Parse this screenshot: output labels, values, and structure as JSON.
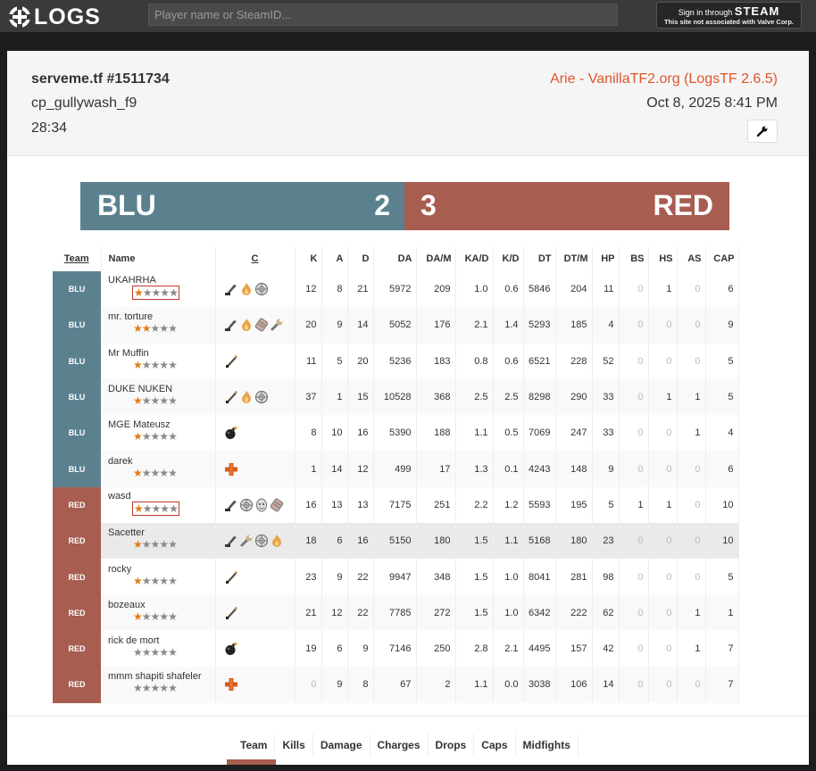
{
  "topbar": {
    "logo_text": "LOGS",
    "search_placeholder": "Player name or SteamID...",
    "steam_signin_prefix": "Sign in through",
    "steam_signin_brand": "STEAM",
    "steam_disclaimer": "This site not associated with Valve Corp."
  },
  "header": {
    "title": "serveme.tf #1511734",
    "map": "cp_gullywash_f9",
    "duration": "28:34",
    "uploader": "Arie - VanillaTF2.org (LogsTF 2.6.5)",
    "date": "Oct 8, 2025 8:41 PM",
    "wrench_icon": "wrench-icon"
  },
  "score": {
    "blu_name": "BLU",
    "blu_score": "2",
    "red_score": "3",
    "red_name": "RED",
    "blu_color": "#5b818f",
    "red_color": "#a75d50"
  },
  "table": {
    "headers": [
      "Team",
      "Name",
      "C",
      "K",
      "A",
      "D",
      "DA",
      "DA/M",
      "KA/D",
      "K/D",
      "DT",
      "DT/M",
      "HP",
      "BS",
      "HS",
      "AS",
      "CAP"
    ],
    "rows": [
      {
        "team": "BLU",
        "name": "UKAHRHA",
        "stars": 1,
        "boxed": true,
        "classes": [
          "scout",
          "pyro",
          "sniper"
        ],
        "stats": [
          "12",
          "8",
          "21",
          "5972",
          "209",
          "1.0",
          "0.6",
          "5846",
          "204",
          "11",
          "0",
          "1",
          "0",
          "6"
        ]
      },
      {
        "team": "BLU",
        "name": "mr. torture",
        "stars": 2,
        "boxed": false,
        "classes": [
          "scout",
          "pyro",
          "heavy",
          "engineer"
        ],
        "stats": [
          "20",
          "9",
          "14",
          "5052",
          "176",
          "2.1",
          "1.4",
          "5293",
          "185",
          "4",
          "0",
          "0",
          "0",
          "9"
        ]
      },
      {
        "team": "BLU",
        "name": "Mr Muffin",
        "stars": 1,
        "boxed": false,
        "classes": [
          "soldier"
        ],
        "stats": [
          "11",
          "5",
          "20",
          "5236",
          "183",
          "0.8",
          "0.6",
          "6521",
          "228",
          "52",
          "0",
          "0",
          "0",
          "5"
        ]
      },
      {
        "team": "BLU",
        "name": "DUKE NUKEN",
        "stars": 1,
        "boxed": false,
        "classes": [
          "soldier",
          "pyro",
          "sniper"
        ],
        "stats": [
          "37",
          "1",
          "15",
          "10528",
          "368",
          "2.5",
          "2.5",
          "8298",
          "290",
          "33",
          "0",
          "1",
          "1",
          "5"
        ]
      },
      {
        "team": "BLU",
        "name": "MGE Mateusz",
        "stars": 1,
        "boxed": false,
        "classes": [
          "demoman"
        ],
        "stats": [
          "8",
          "10",
          "16",
          "5390",
          "188",
          "1.1",
          "0.5",
          "7069",
          "247",
          "33",
          "0",
          "0",
          "1",
          "4"
        ]
      },
      {
        "team": "BLU",
        "name": "darek",
        "stars": 1,
        "boxed": false,
        "classes": [
          "medic"
        ],
        "stats": [
          "1",
          "14",
          "12",
          "499",
          "17",
          "1.3",
          "0.1",
          "4243",
          "148",
          "9",
          "0",
          "0",
          "0",
          "6"
        ]
      },
      {
        "team": "RED",
        "name": "wasd",
        "stars": 1,
        "boxed": true,
        "classes": [
          "scout",
          "sniper",
          "spy",
          "heavy"
        ],
        "stats": [
          "16",
          "13",
          "13",
          "7175",
          "251",
          "2.2",
          "1.2",
          "5593",
          "195",
          "5",
          "1",
          "1",
          "0",
          "10"
        ]
      },
      {
        "team": "RED",
        "name": "Sacetter",
        "stars": 1,
        "boxed": false,
        "classes": [
          "scout",
          "engineer",
          "sniper",
          "pyro"
        ],
        "stats": [
          "18",
          "6",
          "16",
          "5150",
          "180",
          "1.5",
          "1.1",
          "5168",
          "180",
          "23",
          "0",
          "0",
          "0",
          "10"
        ]
      },
      {
        "team": "RED",
        "name": "rocky",
        "stars": 1,
        "boxed": false,
        "classes": [
          "soldier"
        ],
        "stats": [
          "23",
          "9",
          "22",
          "9947",
          "348",
          "1.5",
          "1.0",
          "8041",
          "281",
          "98",
          "0",
          "0",
          "0",
          "5"
        ]
      },
      {
        "team": "RED",
        "name": "bozeaux",
        "stars": 1,
        "boxed": false,
        "classes": [
          "soldier"
        ],
        "stats": [
          "21",
          "12",
          "22",
          "7785",
          "272",
          "1.5",
          "1.0",
          "6342",
          "222",
          "62",
          "0",
          "0",
          "1",
          "1"
        ]
      },
      {
        "team": "RED",
        "name": "rick de mort",
        "stars": 0,
        "boxed": false,
        "classes": [
          "demoman"
        ],
        "stats": [
          "19",
          "6",
          "9",
          "7146",
          "250",
          "2.8",
          "2.1",
          "4495",
          "157",
          "42",
          "0",
          "0",
          "1",
          "7"
        ]
      },
      {
        "team": "RED",
        "name": "mmm shapiti shafeler",
        "stars": 0,
        "boxed": false,
        "classes": [
          "medic"
        ],
        "stats": [
          "0",
          "9",
          "8",
          "67",
          "2",
          "1.1",
          "0.0",
          "3038",
          "106",
          "14",
          "0",
          "0",
          "0",
          "7"
        ]
      }
    ]
  },
  "team_summary": {
    "headers": [
      "Team",
      "Kills",
      "Damage",
      "Charges",
      "Drops",
      "Caps",
      "Midfights"
    ]
  }
}
